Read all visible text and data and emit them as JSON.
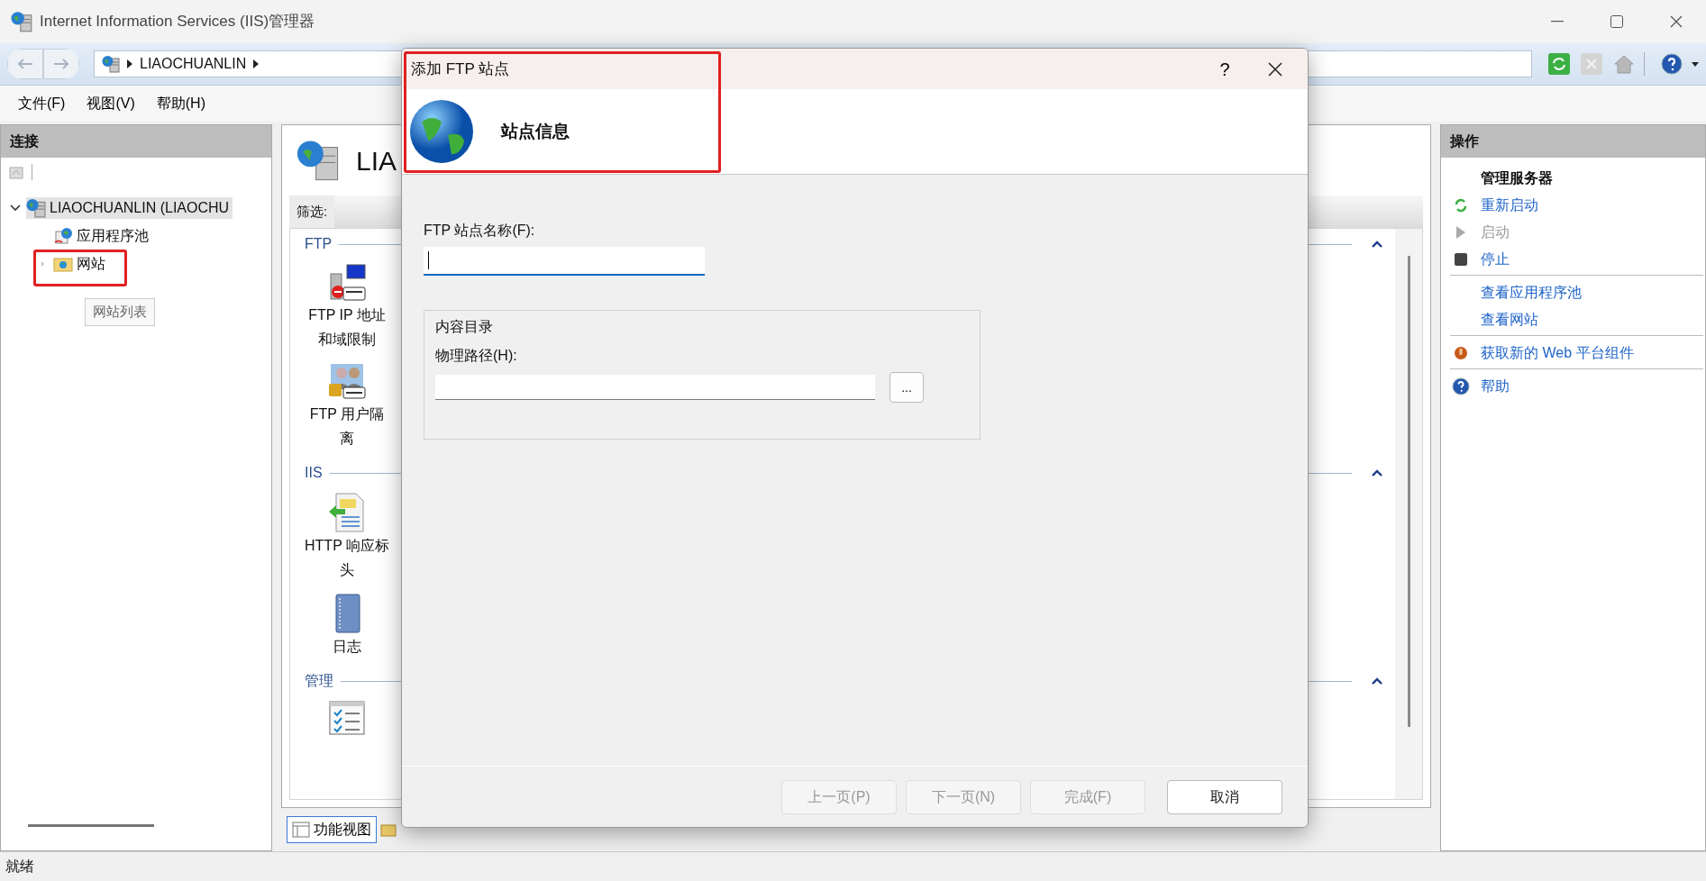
{
  "window": {
    "title": "Internet Information Services (IIS)管理器"
  },
  "nav_buttons": [
    {
      "kind": "back",
      "disabled": true
    },
    {
      "kind": "forward",
      "disabled": true
    }
  ],
  "address_bar": {
    "segments": [
      "LIAOCHUANLIN"
    ]
  },
  "toolbar_icons": [
    {
      "kind": "refresh",
      "disabled": false
    },
    {
      "kind": "stop",
      "disabled": true
    },
    {
      "kind": "home",
      "disabled": false
    },
    {
      "kind": "help",
      "disabled": false
    }
  ],
  "menu": [
    "文件(F)",
    "视图(V)",
    "帮助(H)"
  ],
  "connections": {
    "title": "连接",
    "tooltip": "网站列表",
    "tree": [
      {
        "label": "LIAOCHUANLIN (LIAOCHU",
        "kind": "server",
        "selected": true,
        "expanded": true,
        "highlighted": false,
        "children": [
          {
            "label": "应用程序池",
            "kind": "app-pools",
            "selected": false,
            "highlighted": false
          },
          {
            "label": "网站",
            "kind": "sites",
            "selected": false,
            "expanded": false,
            "highlighted": true
          }
        ]
      }
    ]
  },
  "home": {
    "title": "LIA",
    "filter_label": "筛选:",
    "groups": [
      {
        "title": "FTP",
        "expanded": true,
        "features": [
          {
            "label": "FTP IP 地址和域限制",
            "kind": "ftp-ip"
          },
          {
            "label": "FTP 用户隔离",
            "kind": "ftp-user"
          }
        ]
      },
      {
        "title": "IIS",
        "expanded": true,
        "features": [
          {
            "label": "HTTP 响应标头",
            "kind": "http-headers"
          },
          {
            "label": "日志",
            "kind": "logging"
          }
        ]
      },
      {
        "title": "管理",
        "expanded": true,
        "features": [
          {
            "kind": "config"
          }
        ]
      }
    ],
    "view_tabs": [
      {
        "label": "功能视图",
        "kind": "features",
        "selected": true
      },
      {
        "kind": "content",
        "selected": false
      }
    ]
  },
  "actions": {
    "title": "操作",
    "groups": [
      {
        "items": [
          {
            "label": "管理服务器",
            "kind": "heading",
            "disabled": false
          },
          {
            "label": "重新启动",
            "kind": "restart",
            "disabled": false
          },
          {
            "label": "启动",
            "kind": "start",
            "disabled": true
          },
          {
            "label": "停止",
            "kind": "stop",
            "disabled": false
          }
        ]
      },
      {
        "items": [
          {
            "label": "查看应用程序池",
            "kind": "link",
            "disabled": false
          },
          {
            "label": "查看网站",
            "kind": "link",
            "disabled": false
          }
        ]
      },
      {
        "items": [
          {
            "label": "获取新的 Web 平台组件",
            "kind": "web-platform",
            "disabled": false
          }
        ]
      },
      {
        "items": [
          {
            "label": "帮助",
            "kind": "help",
            "disabled": false
          }
        ]
      }
    ]
  },
  "dialog": {
    "title": "添加 FTP 站点",
    "help": "?",
    "header": "站点信息",
    "header_highlighted": true,
    "site_name": {
      "label": "FTP 站点名称(F):",
      "focused": true
    },
    "content_directory": {
      "title": "内容目录",
      "path_label": "物理路径(H):",
      "browse": "..."
    },
    "buttons": [
      {
        "label": "上一页(P)",
        "disabled": true,
        "default": false
      },
      {
        "label": "下一页(N)",
        "disabled": true,
        "default": false
      },
      {
        "label": "完成(F)",
        "disabled": true,
        "default": false
      },
      {
        "label": "取消",
        "disabled": false,
        "default": true
      }
    ]
  },
  "status_bar": {
    "text": "就绪"
  }
}
